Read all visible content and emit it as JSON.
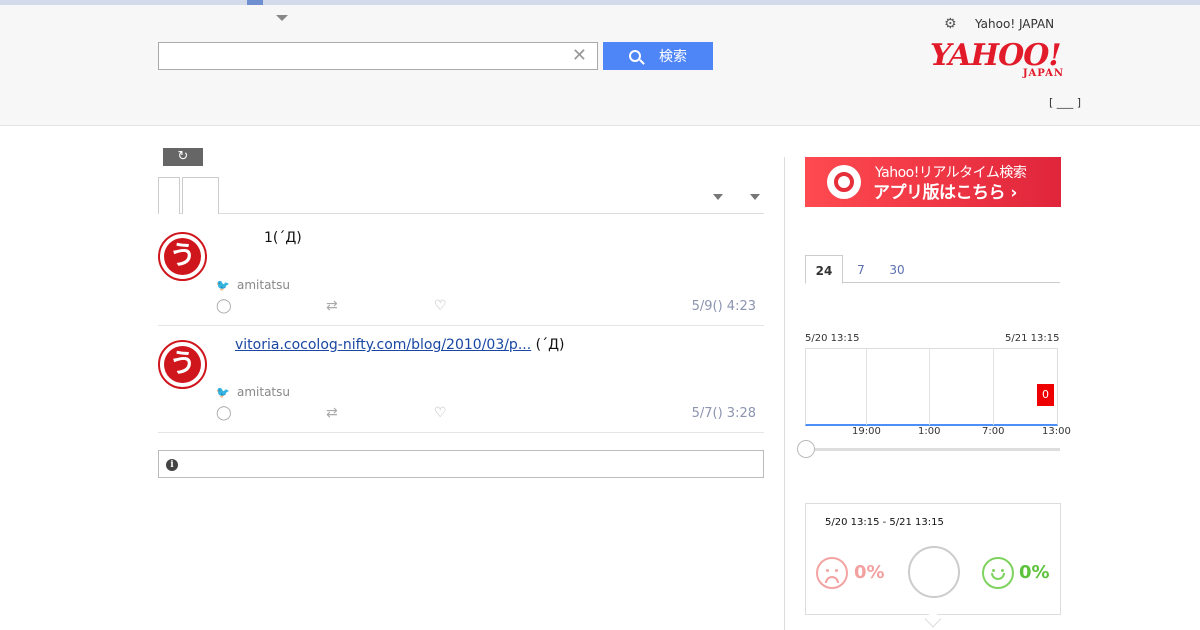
{
  "header": {
    "site_link": "Yahoo! JAPAN",
    "search_button_label": "検索",
    "search_value": "",
    "search_placeholder": "",
    "logo_main": "YAHOO!",
    "logo_sub": "JAPAN",
    "bracket_text": "[ ___ ]"
  },
  "feed": {
    "tweets": [
      {
        "text": "1(´Д)",
        "link": "",
        "user": "amitatsu",
        "time": "5/9() 4:23",
        "avatar_char": "う"
      },
      {
        "text": "(´Д)",
        "link": "vitoria.cocolog-nifty.com/blog/2010/03/p...",
        "user": "amitatsu",
        "time": "5/7() 3:28",
        "avatar_char": "う"
      }
    ]
  },
  "banner": {
    "line1": "Yahoo!リアルタイム検索",
    "line2": "アプリ版はこちら ›"
  },
  "range_tabs": [
    "24",
    "7",
    "30"
  ],
  "chart_data": {
    "type": "bar",
    "start_label": "5/20 13:15",
    "end_label": "5/21 13:15",
    "x_ticks": [
      "19:00",
      "1:00",
      "7:00",
      "13:00"
    ],
    "values": [
      0
    ],
    "current_value_label": "0"
  },
  "sentiment": {
    "range": "5/20 13:15 - 5/21 13:15",
    "negative_pct": "0%",
    "positive_pct": "0%"
  },
  "colors": {
    "accent_blue": "#4f86f7",
    "brand_red": "#e21b2a",
    "twitter_blue": "#1da1f2"
  }
}
